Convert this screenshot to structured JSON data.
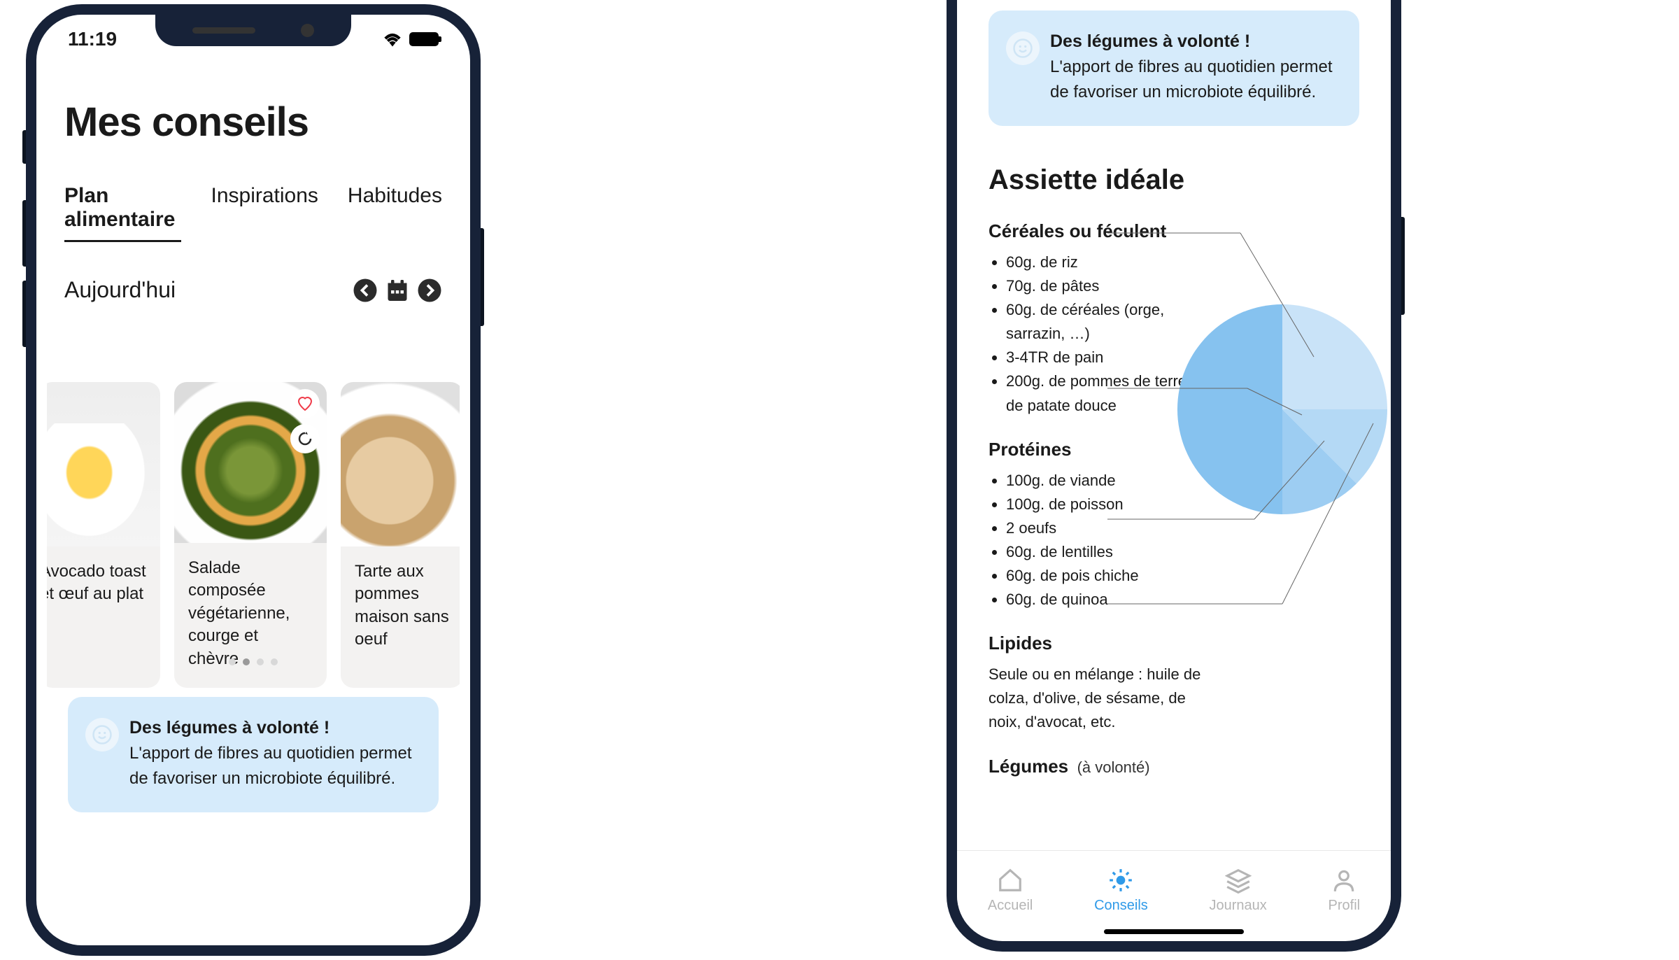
{
  "status_bar": {
    "time": "11:19"
  },
  "page_title": "Mes conseils",
  "tabs": {
    "plan_alimentaire": "Plan alimentaire",
    "inspirations": "Inspirations",
    "habitudes": "Habitudes"
  },
  "today_label": "Aujourd'hui",
  "recipes": {
    "r0": {
      "title": "Avocado toast et œuf au plat"
    },
    "r1": {
      "title": "Salade composée végétarienne, courge et chèvre"
    },
    "r2": {
      "title": "Tarte aux pommes maison sans oeuf"
    }
  },
  "tip": {
    "title": "Des légumes à volonté !",
    "text": "L'apport de fibres au quotidien permet de favoriser un microbiote équilibré."
  },
  "ideal_plate": {
    "title": "Assiette idéale",
    "cereales": {
      "title": "Céréales ou féculent",
      "i0": "60g. de riz",
      "i1": "70g. de pâtes",
      "i2": "60g. de céréales (orge, sarrazin, …)",
      "i3": "3-4TR de pain",
      "i4": "200g. de pommes de terre ou de patate douce"
    },
    "proteines": {
      "title": "Protéines",
      "i0": "100g. de viande",
      "i1": "100g. de poisson",
      "i2": "2 oeufs",
      "i3": "60g. de lentilles",
      "i4": "60g. de pois chiche",
      "i5": "60g. de quinoa"
    },
    "lipides": {
      "title": "Lipides",
      "desc": "Seule ou en mélange : huile de colza, d'olive, de sésame, de noix, d'avocat, etc."
    },
    "legumes": {
      "title": "Légumes",
      "sub": "(à volonté)"
    }
  },
  "chart_data": {
    "type": "pie",
    "title": "Assiette idéale",
    "series": [
      {
        "name": "Céréales ou féculent",
        "value": 25,
        "color": "#c9e3f8"
      },
      {
        "name": "Protéines",
        "value": 12.5,
        "color": "#b4d9f5"
      },
      {
        "name": "Lipides",
        "value": 12.5,
        "color": "#9dcdf2"
      },
      {
        "name": "Légumes",
        "value": 50,
        "color": "#86c2ef"
      }
    ]
  },
  "nav": {
    "accueil": "Accueil",
    "conseils": "Conseils",
    "journaux": "Journaux",
    "profil": "Profil"
  }
}
